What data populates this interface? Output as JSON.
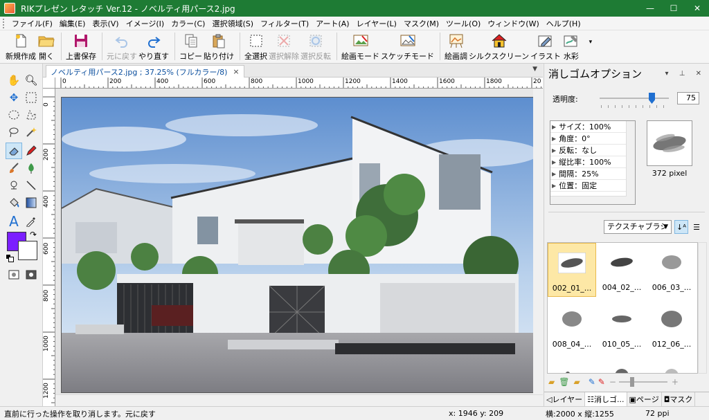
{
  "window": {
    "title": "RIKプレゼン レタッチ Ver.12 - ノベルティ用パース2.jpg",
    "min": "—",
    "max": "☐",
    "close": "✕"
  },
  "menu": [
    "ファイル(F)",
    "編集(E)",
    "表示(V)",
    "イメージ(I)",
    "カラー(C)",
    "選択領域(S)",
    "フィルター(T)",
    "アート(A)",
    "レイヤー(L)",
    "マスク(M)",
    "ツール(O)",
    "ウィンドウ(W)",
    "ヘルプ(H)"
  ],
  "toolbar": {
    "new": "新規作成",
    "open": "開く",
    "overwrite": "上書保存",
    "undo": "元に戻す",
    "redo": "やり直す",
    "copy": "コピー",
    "paste": "貼り付け",
    "select_all": "全選択",
    "deselect": "選択解除",
    "invert": "選択反転",
    "paint_mode": "絵画モード",
    "sketch_mode": "スケッチモード",
    "paint_tone": "絵画調",
    "silkscreen": "シルクスクリーン",
    "illust": "イラスト",
    "watercolor": "水彩",
    "more": "▾"
  },
  "document": {
    "tab_label": "ノベルティ用パース2.jpg ; 37.25% (フルカラー/8)",
    "close": "×"
  },
  "ruler_h": [
    "0",
    "200",
    "400",
    "600",
    "800",
    "1000",
    "1200",
    "1400",
    "1600",
    "1800",
    "20"
  ],
  "ruler_v": [
    "0",
    "200",
    "400",
    "600",
    "800",
    "1000",
    "1200"
  ],
  "panel": {
    "title": "消しゴムオプション",
    "opacity_label": "透明度:",
    "opacity_value": "75",
    "opacity_fraction": 0.75,
    "props": [
      "サイズ：100%",
      "角度：0°",
      "反転：なし",
      "縦比率：100%",
      "間隔：25%",
      "位置：固定"
    ],
    "brush_size": "372 pixel",
    "brush_type": "テクスチャブラシ",
    "brushes": [
      "002_01_...",
      "004_02_...",
      "006_03_...",
      "008_04_...",
      "010_05_...",
      "012_06_..."
    ],
    "tabs": [
      "レイヤー",
      "消しゴ...",
      "ページ",
      "マスク"
    ]
  },
  "status": {
    "message": "直前に行った操作を取り消します。元に戻す",
    "coords": "x: 1946 y: 209",
    "size": "横:2000 x 縦:1255",
    "ppi": "72 ppi"
  },
  "colors": {
    "titlebar": "#1e7b34",
    "foreground": "#7b1fff",
    "background": "#ffffff",
    "selected_brush": "#fde8a6"
  }
}
